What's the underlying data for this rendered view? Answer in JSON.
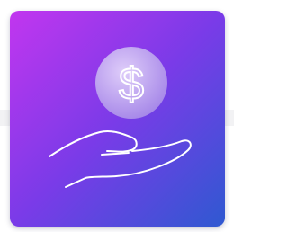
{
  "card": {
    "gradient_start": "#c236ef",
    "gradient_mid": "#7a3be8",
    "gradient_end": "#2f59d1",
    "line_color": "#ffffff"
  },
  "coin": {
    "symbol": "$",
    "fill": "#c9b3f3",
    "fill_opacity": 0.8
  },
  "icons": [
    "dollar-coin-icon",
    "open-hand-icon"
  ]
}
